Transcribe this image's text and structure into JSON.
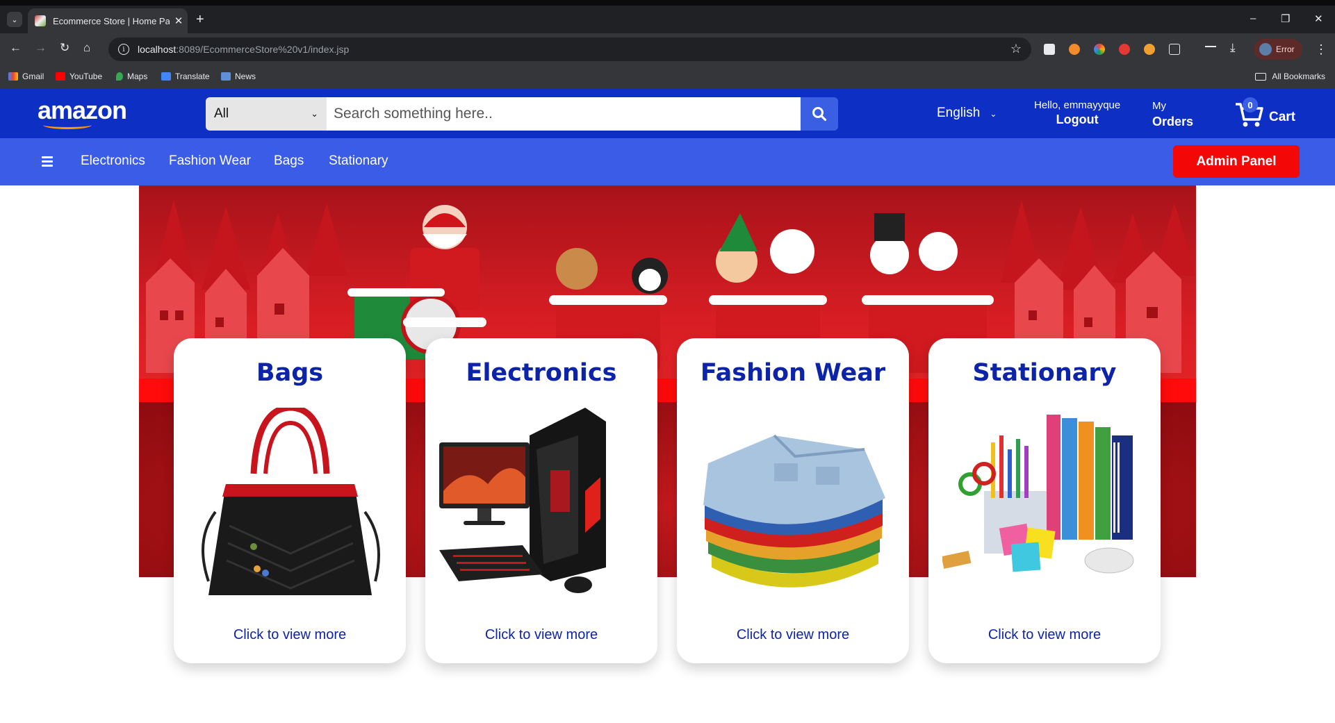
{
  "browser": {
    "tab_title": "Ecommerce Store | Home Page",
    "url_host": "localhost",
    "url_path": ":8089/EcommerceStore%20v1/index.jsp",
    "profile_label": "Error",
    "bookmarks": [
      "Gmail",
      "YouTube",
      "Maps",
      "Translate",
      "News"
    ],
    "all_bookmarks": "All Bookmarks"
  },
  "header": {
    "logo": "amazon",
    "search_category": "All",
    "search_placeholder": "Search something here..",
    "language": "English",
    "greeting": "Hello, emmayyque",
    "logout": "Logout",
    "orders_line1": "My",
    "orders_line2": "Orders",
    "cart_count": "0",
    "cart_label": "Cart"
  },
  "nav": {
    "categories": [
      "Electronics",
      "Fashion Wear",
      "Bags",
      "Stationary"
    ],
    "admin_button": "Admin Panel"
  },
  "cards": [
    {
      "title": "Bags",
      "link": "Click to view more"
    },
    {
      "title": "Electronics",
      "link": "Click to view more"
    },
    {
      "title": "Fashion Wear",
      "link": "Click to view more"
    },
    {
      "title": "Stationary",
      "link": "Click to view more"
    }
  ],
  "colors": {
    "header_bg": "#0d2fc4",
    "nav_bg": "#3b5ce6",
    "admin_button": "#f40707",
    "card_title": "#0d24a8"
  }
}
